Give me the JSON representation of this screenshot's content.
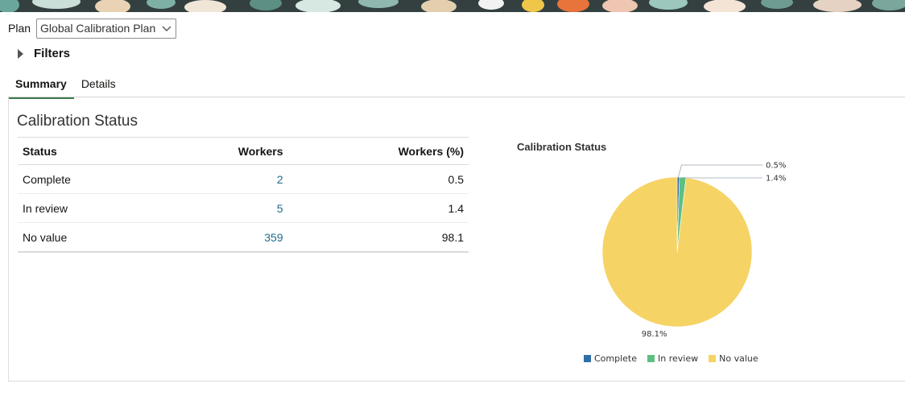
{
  "plan": {
    "label": "Plan",
    "value": "Global Calibration Plan"
  },
  "filters": {
    "label": "Filters"
  },
  "tabs": [
    {
      "label": "Summary",
      "active": true
    },
    {
      "label": "Details",
      "active": false
    }
  ],
  "section": {
    "title": "Calibration Status"
  },
  "table": {
    "headers": [
      "Status",
      "Workers",
      "Workers (%)"
    ],
    "rows": [
      {
        "status": "Complete",
        "workers": "2",
        "pct": "0.5"
      },
      {
        "status": "In review",
        "workers": "5",
        "pct": "1.4"
      },
      {
        "status": "No value",
        "workers": "359",
        "pct": "98.1"
      }
    ]
  },
  "chart_data": {
    "type": "pie",
    "title": "Calibration Status",
    "categories": [
      "Complete",
      "In review",
      "No value"
    ],
    "values": [
      0.5,
      1.4,
      98.1
    ],
    "labels": [
      "0.5%",
      "1.4%",
      "98.1%"
    ],
    "colors": [
      "#2f6fa7",
      "#5dbf82",
      "#f6d365"
    ],
    "legend": "bottom"
  }
}
